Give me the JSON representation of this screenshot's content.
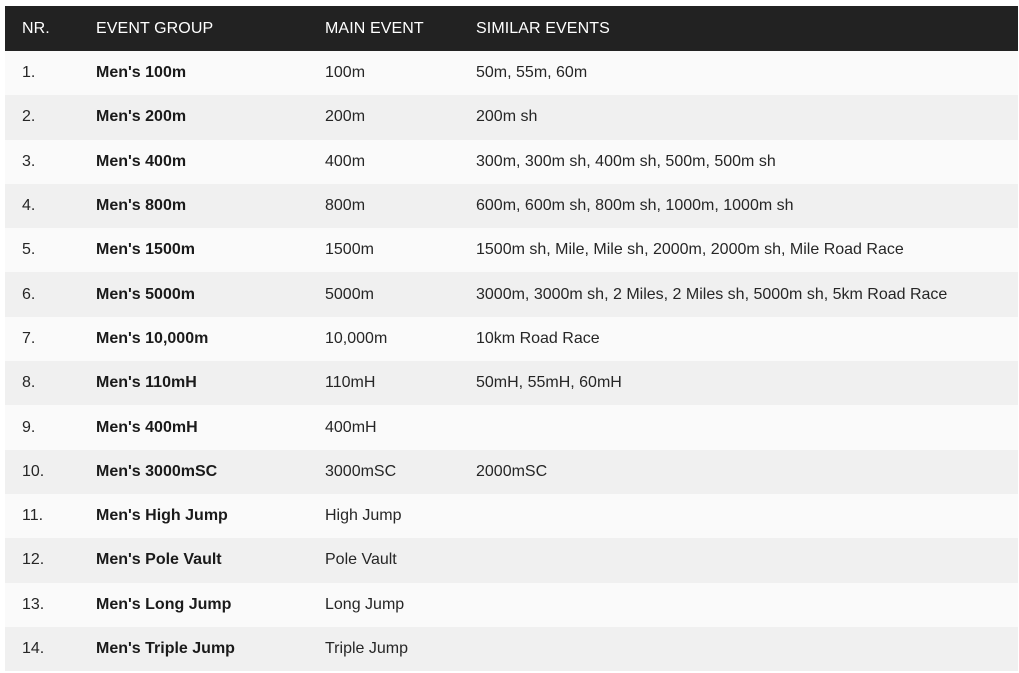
{
  "table": {
    "headers": [
      "NR.",
      "EVENT GROUP",
      "MAIN EVENT",
      "SIMILAR EVENTS"
    ],
    "rows": [
      {
        "nr": "1.",
        "group": "Men's 100m",
        "main": "100m",
        "similar": "50m, 55m, 60m"
      },
      {
        "nr": "2.",
        "group": "Men's 200m",
        "main": "200m",
        "similar": "200m sh"
      },
      {
        "nr": "3.",
        "group": "Men's 400m",
        "main": "400m",
        "similar": "300m, 300m sh, 400m sh, 500m, 500m sh"
      },
      {
        "nr": "4.",
        "group": "Men's 800m",
        "main": "800m",
        "similar": "600m, 600m sh, 800m sh, 1000m, 1000m sh"
      },
      {
        "nr": "5.",
        "group": "Men's 1500m",
        "main": "1500m",
        "similar": "1500m sh, Mile, Mile sh, 2000m, 2000m sh, Mile Road Race"
      },
      {
        "nr": "6.",
        "group": "Men's 5000m",
        "main": "5000m",
        "similar": "3000m, 3000m sh, 2 Miles, 2 Miles sh, 5000m sh, 5km Road Race"
      },
      {
        "nr": "7.",
        "group": "Men's 10,000m",
        "main": "10,000m",
        "similar": "10km Road Race"
      },
      {
        "nr": "8.",
        "group": "Men's 110mH",
        "main": "110mH",
        "similar": "50mH, 55mH, 60mH"
      },
      {
        "nr": "9.",
        "group": "Men's 400mH",
        "main": "400mH",
        "similar": ""
      },
      {
        "nr": "10.",
        "group": "Men's 3000mSC",
        "main": "3000mSC",
        "similar": "2000mSC"
      },
      {
        "nr": "11.",
        "group": "Men's High Jump",
        "main": "High Jump",
        "similar": ""
      },
      {
        "nr": "12.",
        "group": "Men's Pole Vault",
        "main": "Pole Vault",
        "similar": ""
      },
      {
        "nr": "13.",
        "group": "Men's Long Jump",
        "main": "Long Jump",
        "similar": ""
      },
      {
        "nr": "14.",
        "group": "Men's Triple Jump",
        "main": "Triple Jump",
        "similar": ""
      }
    ]
  },
  "colors": {
    "header_bg": "#222222",
    "header_text": "#ffffff",
    "row_odd": "#fafafa",
    "row_even": "#f0f0f0"
  }
}
